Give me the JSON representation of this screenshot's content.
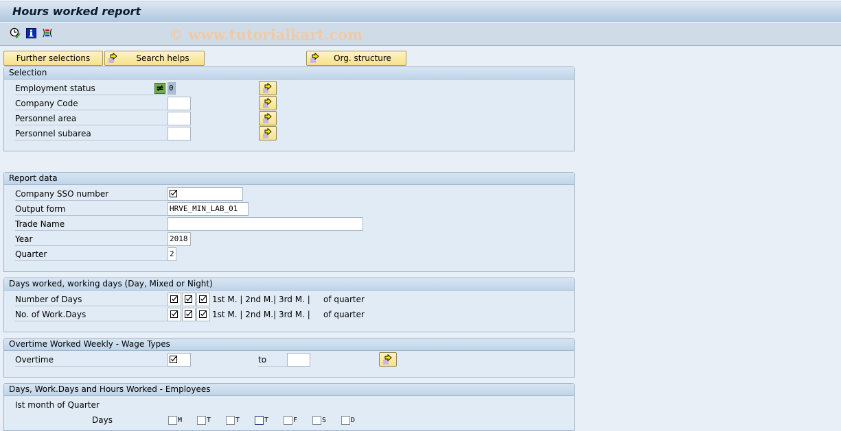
{
  "window": {
    "title": "Hours worked report"
  },
  "toolbar": {
    "icons": [
      "execute-clock-icon",
      "info-icon",
      "selection-options-icon"
    ],
    "watermark": "© www.tutorialkart.com"
  },
  "buttons": {
    "further_selections": "Further selections",
    "search_helps": "Search helps",
    "org_structure": "Org. structure"
  },
  "selection": {
    "title": "Selection",
    "fields": [
      {
        "label": "Employment status",
        "value": "0",
        "operator": "≠"
      },
      {
        "label": "Company Code",
        "value": ""
      },
      {
        "label": "Personnel area",
        "value": ""
      },
      {
        "label": "Personnel subarea",
        "value": ""
      }
    ]
  },
  "report_data": {
    "title": "Report data",
    "fields": [
      {
        "label": "Company SSO number",
        "value": "☑"
      },
      {
        "label": "Output form",
        "value": "HRVE_MIN_LAB_01"
      },
      {
        "label": "Trade Name",
        "value": ""
      },
      {
        "label": "Year",
        "value": "2018"
      },
      {
        "label": "Quarter",
        "value": "2"
      }
    ]
  },
  "days_worked": {
    "title": "Days worked, working days (Day, Mixed or Night)",
    "rows": [
      {
        "label": "Number of Days",
        "checked": [
          true,
          true,
          true
        ],
        "months": "1st M. | 2nd M.| 3rd M. |",
        "suffix": "of quarter"
      },
      {
        "label": "No. of Work.Days",
        "checked": [
          true,
          true,
          true
        ],
        "months": "1st M. | 2nd M.| 3rd M. |",
        "suffix": "of quarter"
      }
    ]
  },
  "overtime": {
    "title": "Overtime Worked Weekly - Wage Types",
    "label": "Overtime",
    "from_value": "☑",
    "to_label": "to",
    "to_value": ""
  },
  "employees": {
    "title": "Days, Work.Days and Hours Worked - Employees",
    "month_label": "Ist month of Quarter",
    "days_label": "Days",
    "days": [
      {
        "label": "M",
        "checked": false
      },
      {
        "label": "T",
        "checked": false
      },
      {
        "label": "T",
        "checked": false
      },
      {
        "label": "T",
        "checked": false
      },
      {
        "label": "F",
        "checked": false
      },
      {
        "label": "S",
        "checked": false
      },
      {
        "label": "D",
        "checked": false
      }
    ]
  }
}
